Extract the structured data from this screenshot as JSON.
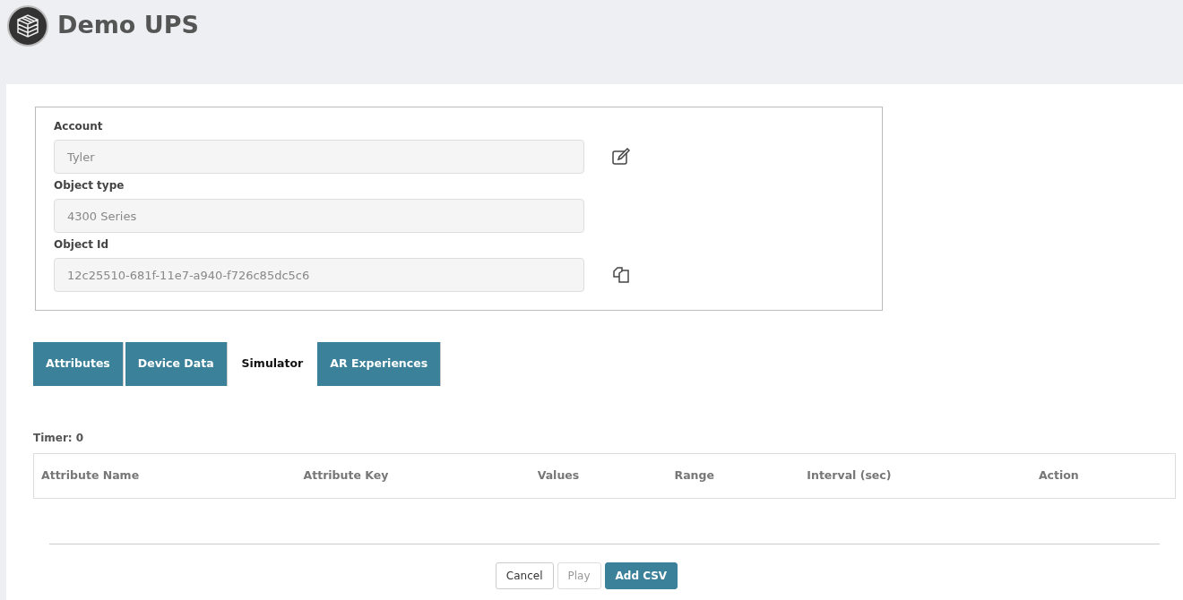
{
  "header": {
    "title": "Demo UPS"
  },
  "fields": [
    {
      "label": "Account",
      "value": "Tyler",
      "kind": "edit"
    },
    {
      "label": "Object type",
      "value": "4300 Series",
      "kind": "plain"
    },
    {
      "label": "Object Id",
      "value": "12c25510-681f-11e7-a940-f726c85dc5c6",
      "kind": "copy"
    }
  ],
  "tabs": [
    {
      "label": "Attributes",
      "selected": false
    },
    {
      "label": "Device Data",
      "selected": false
    },
    {
      "label": "Simulator",
      "selected": true
    },
    {
      "label": "AR Experiences",
      "selected": false
    }
  ],
  "timer": "Timer: 0",
  "table": {
    "columns": [
      "Attribute Name",
      "Attribute Key",
      "Values",
      "Range",
      "Interval (sec)",
      "Action"
    ]
  },
  "buttons": [
    {
      "label": "Cancel",
      "kind": "default",
      "disabled": false
    },
    {
      "label": "Play",
      "kind": "default",
      "disabled": true
    },
    {
      "label": "Add CSV",
      "kind": "primary",
      "disabled": false
    }
  ]
}
